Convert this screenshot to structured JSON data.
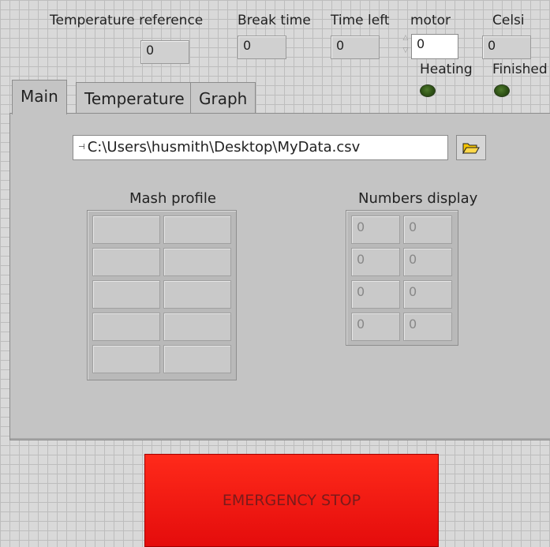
{
  "indicators": {
    "temperature_reference": {
      "label": "Temperature reference",
      "value": "0"
    },
    "break_time": {
      "label": "Break time",
      "value": "0"
    },
    "time_left": {
      "label": "Time left",
      "value": "0"
    },
    "motor": {
      "label": "motor",
      "value": "0"
    },
    "celsi": {
      "label": "Celsi",
      "value": "0"
    }
  },
  "leds": {
    "heating": {
      "label": "Heating",
      "state": "off",
      "color": "#2f5216"
    },
    "finished": {
      "label": "Finished",
      "state": "off",
      "color": "#2f5216"
    }
  },
  "tabs": [
    {
      "label": "Main",
      "active": true
    },
    {
      "label": "Temperature",
      "active": false
    },
    {
      "label": "Graph",
      "active": false
    }
  ],
  "main": {
    "file_path": "C:\\Users\\husmith\\Desktop\\MyData.csv",
    "mash_profile_label": "Mash profile",
    "numbers_display_label": "Numbers display",
    "numbers_display": [
      [
        "0",
        "0"
      ],
      [
        "0",
        "0"
      ],
      [
        "0",
        "0"
      ],
      [
        "0",
        "0"
      ]
    ]
  },
  "emergency_stop": {
    "label": "EMERGENCY STOP",
    "color": "#ff2a1a"
  }
}
